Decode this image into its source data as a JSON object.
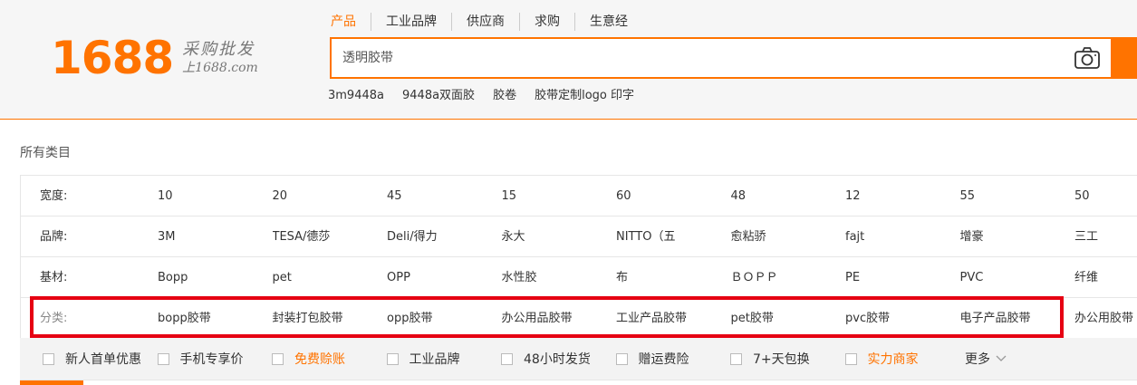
{
  "logo": {
    "number": "1688",
    "slogan_line1": "采购批发",
    "slogan_line2": "上1688.com",
    "color": "#ff7300"
  },
  "search": {
    "tabs": [
      {
        "label": "产品",
        "active": true
      },
      {
        "label": "工业品牌",
        "active": false
      },
      {
        "label": "供应商",
        "active": false
      },
      {
        "label": "求购",
        "active": false
      },
      {
        "label": "生意经",
        "active": false
      }
    ],
    "placeholder": "透明胶带",
    "camera_icon": "camera-icon",
    "hot_words": [
      "3m9448a",
      "9448a双面胶",
      "胶卷",
      "胶带定制logo 印字"
    ]
  },
  "breadcrumb": "所有类目",
  "filters": [
    {
      "label": "宽度:",
      "values": [
        "10",
        "20",
        "45",
        "15",
        "60",
        "48",
        "12",
        "55",
        "50"
      ]
    },
    {
      "label": "品牌:",
      "values": [
        "3M",
        "TESA/德莎",
        "Deli/得力",
        "永大",
        "NITTO（五",
        "愈粘骄",
        "fajt",
        "增豪",
        "三工"
      ]
    },
    {
      "label": "基材:",
      "values": [
        "Bopp",
        "pet",
        "OPP",
        "水性胶",
        "布",
        "ＢＯＰＰ",
        "PE",
        "PVC",
        "纤维"
      ]
    },
    {
      "label": "分类:",
      "values": [
        "bopp胶带",
        "封装打包胶带",
        "opp胶带",
        "办公用品胶带",
        "工业产品胶带",
        "pet胶带",
        "pvc胶带",
        "电子产品胶带",
        "办公用胶带"
      ],
      "highlighted": true
    }
  ],
  "options": [
    {
      "label": "新人首单优惠",
      "accent": false
    },
    {
      "label": "手机专享价",
      "accent": false
    },
    {
      "label": "免费赊账",
      "accent": true
    },
    {
      "label": "工业品牌",
      "accent": false
    },
    {
      "label": "48小时发货",
      "accent": false
    },
    {
      "label": "赠运费险",
      "accent": false
    },
    {
      "label": "7+天包换",
      "accent": false
    },
    {
      "label": "实力商家",
      "accent": true
    }
  ],
  "more_label": "更多",
  "colors": {
    "accent": "#ff7300",
    "highlight": "#e60012"
  }
}
